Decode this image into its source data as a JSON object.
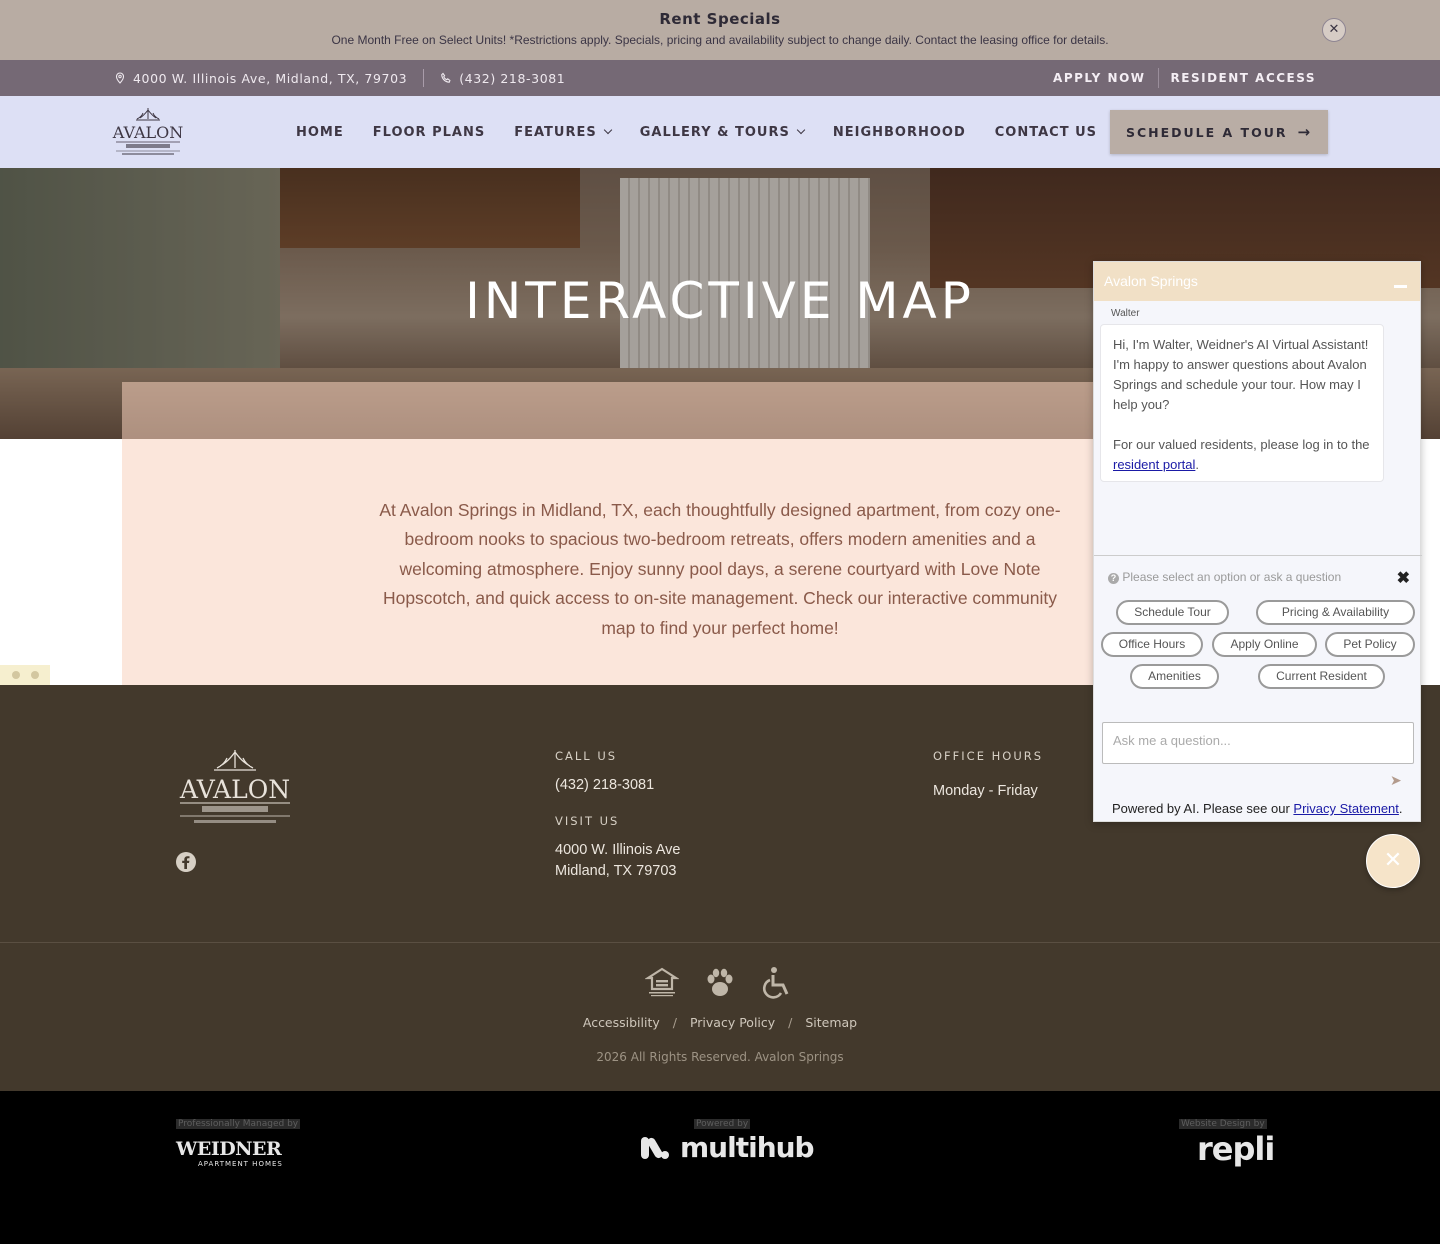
{
  "rent_specials": {
    "title": "Rent Specials",
    "text": "One Month Free on Select Units! *Restrictions apply. Specials, pricing and availability subject to change daily. Contact the leasing office for details.",
    "close_label": "✕"
  },
  "topbar": {
    "address": "4000 W. Illinois Ave, Midland, TX, 79703",
    "phone": "(432) 218-3081",
    "apply_now": "APPLY NOW",
    "resident_access": "RESIDENT ACCESS"
  },
  "nav": {
    "logo_text": "AVALON",
    "items": [
      {
        "label": "HOME",
        "dropdown": false
      },
      {
        "label": "FLOOR PLANS",
        "dropdown": false
      },
      {
        "label": "FEATURES",
        "dropdown": true
      },
      {
        "label": "GALLERY & TOURS",
        "dropdown": true
      },
      {
        "label": "NEIGHBORHOOD",
        "dropdown": false
      },
      {
        "label": "CONTACT US",
        "dropdown": false
      }
    ],
    "cta": "SCHEDULE A TOUR"
  },
  "hero": {
    "title": "INTERACTIVE MAP"
  },
  "intro": {
    "text": "At Avalon Springs in Midland, TX, each thoughtfully designed apartment, from cozy one-bedroom nooks to spacious two-bedroom retreats, offers modern amenities and a welcoming atmosphere. Enjoy sunny pool days, a serene courtyard with Love Note Hopscotch, and quick access to on-site management. Check our interactive community map to find your perfect home!"
  },
  "footer": {
    "call_label": "CALL US",
    "call_value": "(432) 218-3081",
    "visit_label": "VISIT US",
    "visit_line1": "4000 W. Illinois Ave",
    "visit_line2": "Midland, TX 79703",
    "hours_label": "OFFICE HOURS",
    "hours_value": "Monday - Friday",
    "links": [
      "Accessibility",
      "Privacy Policy",
      "Sitemap"
    ],
    "copyright": "2026 All Rights Reserved. Avalon Springs",
    "icons": [
      "equal-housing-icon",
      "pet-friendly-icon",
      "accessibility-icon"
    ]
  },
  "credits": {
    "managed_label": "Professionally Managed by",
    "managed_logo": "WEIDNER",
    "managed_sub": "APARTMENT HOMES",
    "powered_label": "Powered by",
    "powered_logo": "multihub",
    "design_label": "Website Design by",
    "design_logo": "repli"
  },
  "chat": {
    "title": "Avalon Springs",
    "sender": "Walter",
    "message_1": "Hi, I'm Walter, Weidner's AI Virtual Assistant! I'm happy to answer questions about Avalon Springs and schedule your tour. How may I help you?",
    "message_2_prefix": "For our valued residents, please log in to the",
    "message_2_link": "resident portal",
    "message_2_suffix": ".",
    "hint": "Please select an option or ask a question",
    "options": [
      "Schedule Tour",
      "Pricing & Availability",
      "Office Hours",
      "Apply Online",
      "Pet Policy",
      "Amenities",
      "Current Resident"
    ],
    "input_placeholder": "Ask me a question...",
    "footer_prefix": "Powered by AI. Please see our",
    "footer_link": "Privacy Statement",
    "footer_suffix": "."
  }
}
